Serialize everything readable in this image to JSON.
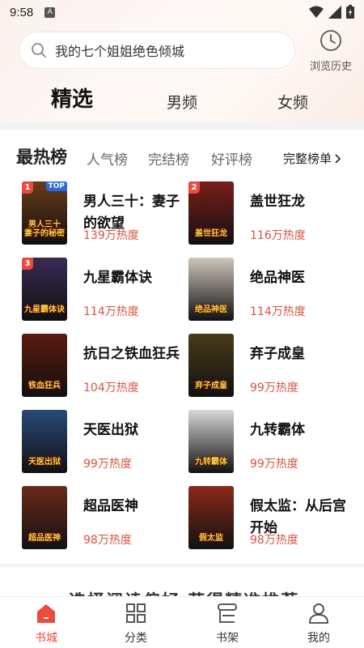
{
  "status_bar": {
    "time": "9:58",
    "notification_glyph": "A"
  },
  "search": {
    "placeholder": "我的七个姐姐绝色倾城"
  },
  "history": {
    "label": "浏览历史"
  },
  "channel_tabs": [
    "精选",
    "男频",
    "女频"
  ],
  "ranking": {
    "title": "最热榜",
    "tabs": [
      "人气榜",
      "完结榜",
      "好评榜"
    ],
    "full_list": "完整榜单",
    "top_badge": "TOP",
    "books": [
      {
        "rank": "1",
        "title": "男人三十：妻子的欲望",
        "heat": "139万热度",
        "cover_text": "男人三十 妻子的秘密",
        "color": "#6a3b1a"
      },
      {
        "rank": "2",
        "title": "盖世狂龙",
        "heat": "116万热度",
        "cover_text": "盖世狂龙",
        "color": "#7a1e1a"
      },
      {
        "rank": "3",
        "title": "九星霸体诀",
        "heat": "114万热度",
        "cover_text": "九星霸体诀",
        "color": "#3a2a55"
      },
      {
        "rank": "",
        "title": "绝品神医",
        "heat": "114万热度",
        "cover_text": "绝品神医",
        "color": "#cfc6bc"
      },
      {
        "rank": "",
        "title": "抗日之铁血狂兵",
        "heat": "104万热度",
        "cover_text": "铁血狂兵",
        "color": "#5a1a10"
      },
      {
        "rank": "",
        "title": "弃子成皇",
        "heat": "99万热度",
        "cover_text": "弃子成皇",
        "color": "#4a3a1a"
      },
      {
        "rank": "",
        "title": "天医出狱",
        "heat": "99万热度",
        "cover_text": "天医出狱",
        "color": "#2a4a7a"
      },
      {
        "rank": "",
        "title": "九转霸体",
        "heat": "99万热度",
        "cover_text": "九转霸体",
        "color": "#d8d8d8"
      },
      {
        "rank": "",
        "title": "超品医神",
        "heat": "98万热度",
        "cover_text": "超品医神",
        "color": "#6a2a1a"
      },
      {
        "rank": "",
        "title": "假太监：从后宫开始",
        "heat": "98万热度",
        "cover_text": "假太监",
        "color": "#8a2a1a"
      }
    ]
  },
  "bottom_strip": {
    "text": "选择阅读偏好 获得精准推荐"
  },
  "bottom_nav": [
    {
      "label": "书城",
      "icon": "home-icon",
      "active": true
    },
    {
      "label": "分类",
      "icon": "category-grid-icon",
      "active": false
    },
    {
      "label": "书架",
      "icon": "bookshelf-icon",
      "active": false
    },
    {
      "label": "我的",
      "icon": "profile-icon",
      "active": false
    }
  ],
  "colors": {
    "accent": "#e94b3c",
    "heat": "#d9533c"
  }
}
